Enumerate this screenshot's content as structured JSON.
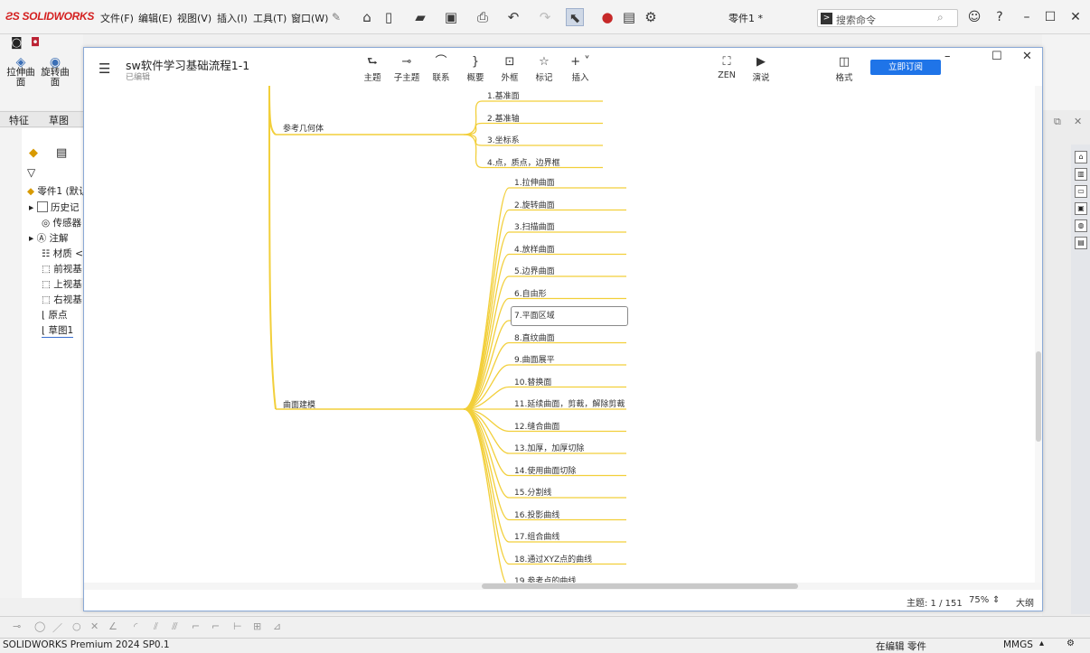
{
  "app": {
    "logo": "SOLIDWORKS",
    "menus": [
      "文件(F)",
      "编辑(E)",
      "视图(V)",
      "插入(I)",
      "工具(T)",
      "窗口(W)"
    ],
    "document_name": "零件1 *",
    "search_placeholder": "搜索命令"
  },
  "command_manager": {
    "buttons": [
      "拉伸曲面",
      "旋转曲面"
    ],
    "tabs": [
      "特征",
      "草图"
    ]
  },
  "feature_tree": {
    "root": "零件1 (默认",
    "items": [
      "历史记",
      "传感器",
      "注解",
      "材质 <",
      "前视基",
      "上视基",
      "右视基",
      "原点",
      "草图1"
    ]
  },
  "mindmap": {
    "title": "sw软件学习基础流程1-1",
    "subtitle": "已编辑",
    "toolbar": [
      "主题",
      "子主题",
      "联系",
      "概要",
      "外框",
      "标记",
      "插入"
    ],
    "toolbar_right": [
      "ZEN",
      "演说",
      "格式"
    ],
    "subscribe": "立即订阅",
    "branches": [
      {
        "label": "参考几何体",
        "children": [
          "1.基准面",
          "2.基准轴",
          "3.坐标系",
          "4.点，质点，边界框"
        ]
      },
      {
        "label": "曲面建模",
        "children": [
          "1.拉伸曲面",
          "2.旋转曲面",
          "3.扫描曲面",
          "4.放样曲面",
          "5.边界曲面",
          "6.自由形",
          "7.平面区域",
          "8.直纹曲面",
          "9.曲面展平",
          "10.替换面",
          "11.延续曲面，剪裁，解除剪裁",
          "12.缝合曲面",
          "13.加厚，加厚切除",
          "14.使用曲面切除",
          "15.分割线",
          "16.投影曲线",
          "17.组合曲线",
          "18.通过XYZ点的曲线",
          "19.参考点的曲线"
        ]
      }
    ],
    "footer": {
      "topic_count": "主题: 1 / 151",
      "zoom": "75%",
      "outline": "大纲"
    }
  },
  "status": {
    "version": "SOLIDWORKS Premium 2024 SP0.1",
    "editing": "在编辑 零件",
    "units": "MMGS"
  },
  "colors": {
    "branch_line": "#f2cf3a",
    "accent": "#1f74e8",
    "logo": "#d42020"
  }
}
